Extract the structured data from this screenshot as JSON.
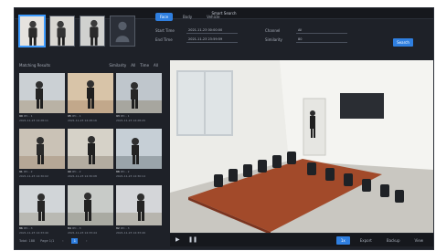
{
  "window": {
    "title": "Smart Search"
  },
  "targets": [
    {
      "name": "target-photo-1",
      "selected": true
    },
    {
      "name": "target-photo-2",
      "selected": false
    },
    {
      "name": "target-photo-3",
      "selected": false
    },
    {
      "name": "target-photo-4",
      "selected": false,
      "empty": true
    }
  ],
  "search": {
    "tabs": [
      {
        "label": "Face",
        "active": true
      },
      {
        "label": "Body",
        "active": false
      },
      {
        "label": "Vehicle",
        "active": false
      }
    ],
    "start_time_label": "Start Time",
    "start_time_value": "2021-11-23 00:00:00",
    "end_time_label": "End Time",
    "end_time_value": "2021-11-23 23:59:59",
    "channel_label": "Channel",
    "channel_value": "All",
    "similarity_label": "Similarity",
    "similarity_value": "80",
    "search_button": "Search"
  },
  "results": {
    "title": "Matching Results",
    "sort_label": "Similarity",
    "sort_value": "All",
    "filter_label": "Time",
    "filter_value": "All",
    "items": [
      {
        "score": "99",
        "camera": "IPC - 1",
        "time": "2021-11-23 14:28:11"
      },
      {
        "score": "95",
        "camera": "IPC - 1",
        "time": "2021-11-23 14:28:16"
      },
      {
        "score": "93",
        "camera": "IPC - 1",
        "time": "2021-11-23 14:28:20"
      },
      {
        "score": "91",
        "camera": "IPC - 2",
        "time": "2021-11-23 14:30:02"
      },
      {
        "score": "90",
        "camera": "IPC - 2",
        "time": "2021-11-23 14:30:08"
      },
      {
        "score": "88",
        "camera": "IPC - 2",
        "time": "2021-11-23 14:30:14"
      },
      {
        "score": "86",
        "camera": "IPC - 3",
        "time": "2021-11-23 14:33:40"
      },
      {
        "score": "84",
        "camera": "IPC - 3",
        "time": "2021-11-23 14:33:44"
      },
      {
        "score": "82",
        "camera": "IPC - 3",
        "time": "2021-11-23 14:33:49"
      }
    ],
    "pager": {
      "total_label": "Total: 188",
      "page_label": "Page 1/1",
      "current_page": "1"
    }
  },
  "video_controls": {
    "play_icon": "play-icon",
    "speed_label": "1x",
    "export_label": "Export",
    "backup_label": "Backup",
    "view_label": "View"
  }
}
